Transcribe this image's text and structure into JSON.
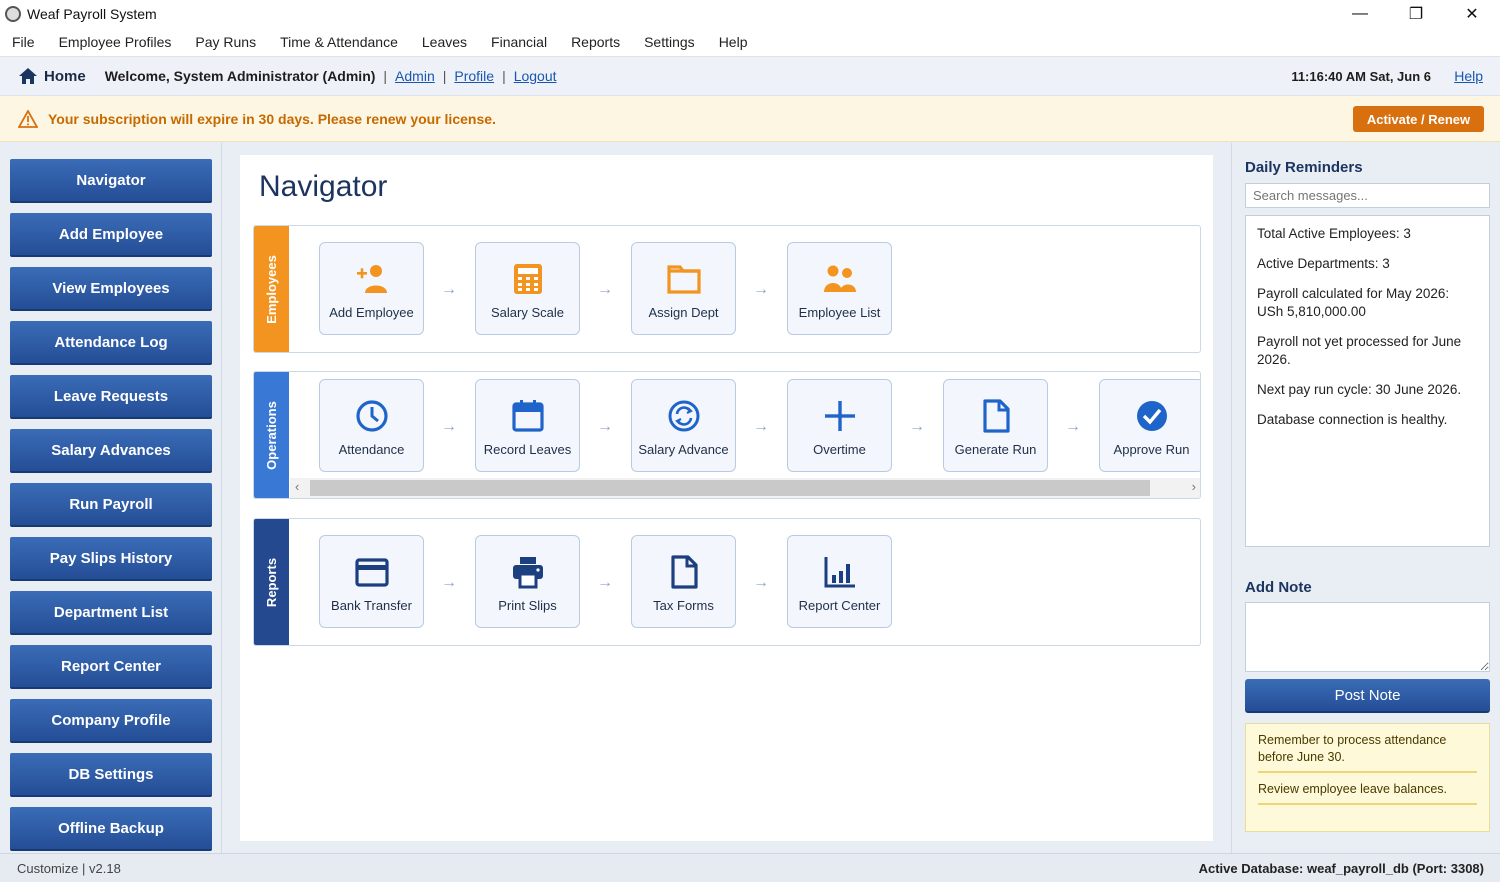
{
  "window": {
    "title": "Weaf Payroll System"
  },
  "menu": [
    "File",
    "Employee Profiles",
    "Pay Runs",
    "Time & Attendance",
    "Leaves",
    "Financial",
    "Reports",
    "Settings",
    "Help"
  ],
  "header": {
    "home": "Home",
    "welcome": "Welcome, System Administrator (Admin)",
    "sep": "|",
    "links": [
      "Admin",
      "Profile",
      "Logout"
    ],
    "clock": "11:16:40 AM Sat, Jun 6",
    "help": "Help"
  },
  "alert": {
    "text": "Your subscription will expire in 30 days. Please renew your license.",
    "button": "Activate / Renew",
    "color": "#d9700f"
  },
  "sidebar": [
    "Navigator",
    "Add Employee",
    "View Employees",
    "Attendance Log",
    "Leave Requests",
    "Salary Advances",
    "Run Payroll",
    "Pay Slips History",
    "Department List",
    "Report Center",
    "Company Profile",
    "DB Settings",
    "Offline Backup"
  ],
  "main": {
    "title": "Navigator",
    "arrow": "→",
    "groups": [
      {
        "label": "Employees",
        "color": "#f2941f",
        "tiles": [
          {
            "label": "Add Employee",
            "icon": "add-person-icon"
          },
          {
            "label": "Salary Scale",
            "icon": "calculator-icon"
          },
          {
            "label": "Assign Dept",
            "icon": "folder-icon"
          },
          {
            "label": "Employee List",
            "icon": "people-icon"
          }
        ]
      },
      {
        "label": "Operations",
        "color": "#3a78d6",
        "tiles": [
          {
            "label": "Attendance",
            "icon": "clock-icon"
          },
          {
            "label": "Record Leaves",
            "icon": "calendar-icon"
          },
          {
            "label": "Salary Advance",
            "icon": "currency-exchange-icon"
          },
          {
            "label": "Overtime",
            "icon": "plus-icon"
          },
          {
            "label": "Generate Run",
            "icon": "document-icon"
          },
          {
            "label": "Approve Run",
            "icon": "check-circle-icon"
          }
        ]
      },
      {
        "label": "Reports",
        "color": "#24498e",
        "tiles": [
          {
            "label": "Bank Transfer",
            "icon": "card-icon"
          },
          {
            "label": "Print Slips",
            "icon": "printer-icon"
          },
          {
            "label": "Tax Forms",
            "icon": "document-icon"
          },
          {
            "label": "Report Center",
            "icon": "bar-chart-icon"
          }
        ]
      }
    ]
  },
  "reminders": {
    "title": "Daily Reminders",
    "search_placeholder": "Search messages...",
    "items": [
      "Total Active Employees: 3",
      "Active Departments: 3",
      "Payroll calculated for May 2026: USh 5,810,000.00",
      "Payroll not yet processed for June 2026.",
      "Next pay run cycle: 30 June 2026.",
      "Database connection is healthy."
    ]
  },
  "notes": {
    "title": "Add Note",
    "button": "Post Note",
    "items": [
      "Remember to process attendance before June 30.",
      "Review employee leave balances."
    ]
  },
  "status": {
    "left": "Customize  |  v2.18",
    "right": "Active Database: weaf_payroll_db (Port: 3308)"
  }
}
